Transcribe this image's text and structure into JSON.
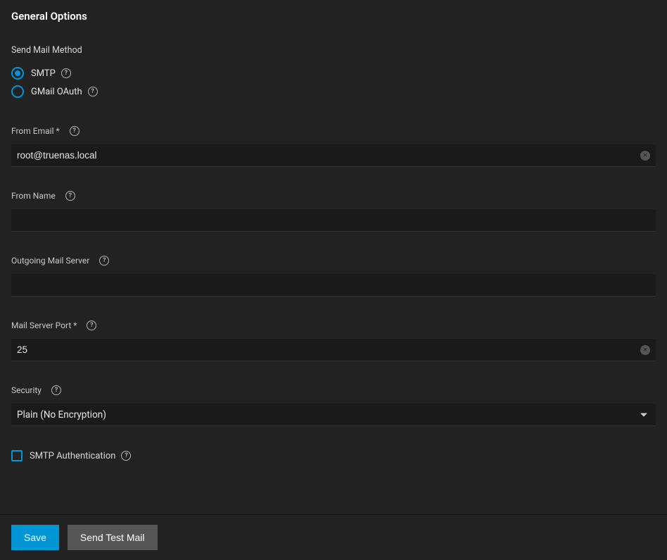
{
  "title": "General Options",
  "sendMethod": {
    "label": "Send Mail Method",
    "options": [
      {
        "label": "SMTP",
        "selected": true
      },
      {
        "label": "GMail OAuth",
        "selected": false
      }
    ]
  },
  "fields": {
    "fromEmail": {
      "label": "From Email *",
      "value": "root@truenas.local"
    },
    "fromName": {
      "label": "From Name",
      "value": ""
    },
    "outgoingServer": {
      "label": "Outgoing Mail Server",
      "value": ""
    },
    "port": {
      "label": "Mail Server Port *",
      "value": "25"
    },
    "security": {
      "label": "Security",
      "value": "Plain (No Encryption)"
    },
    "smtpAuth": {
      "label": "SMTP Authentication",
      "checked": false
    }
  },
  "buttons": {
    "save": "Save",
    "sendTest": "Send Test Mail"
  }
}
